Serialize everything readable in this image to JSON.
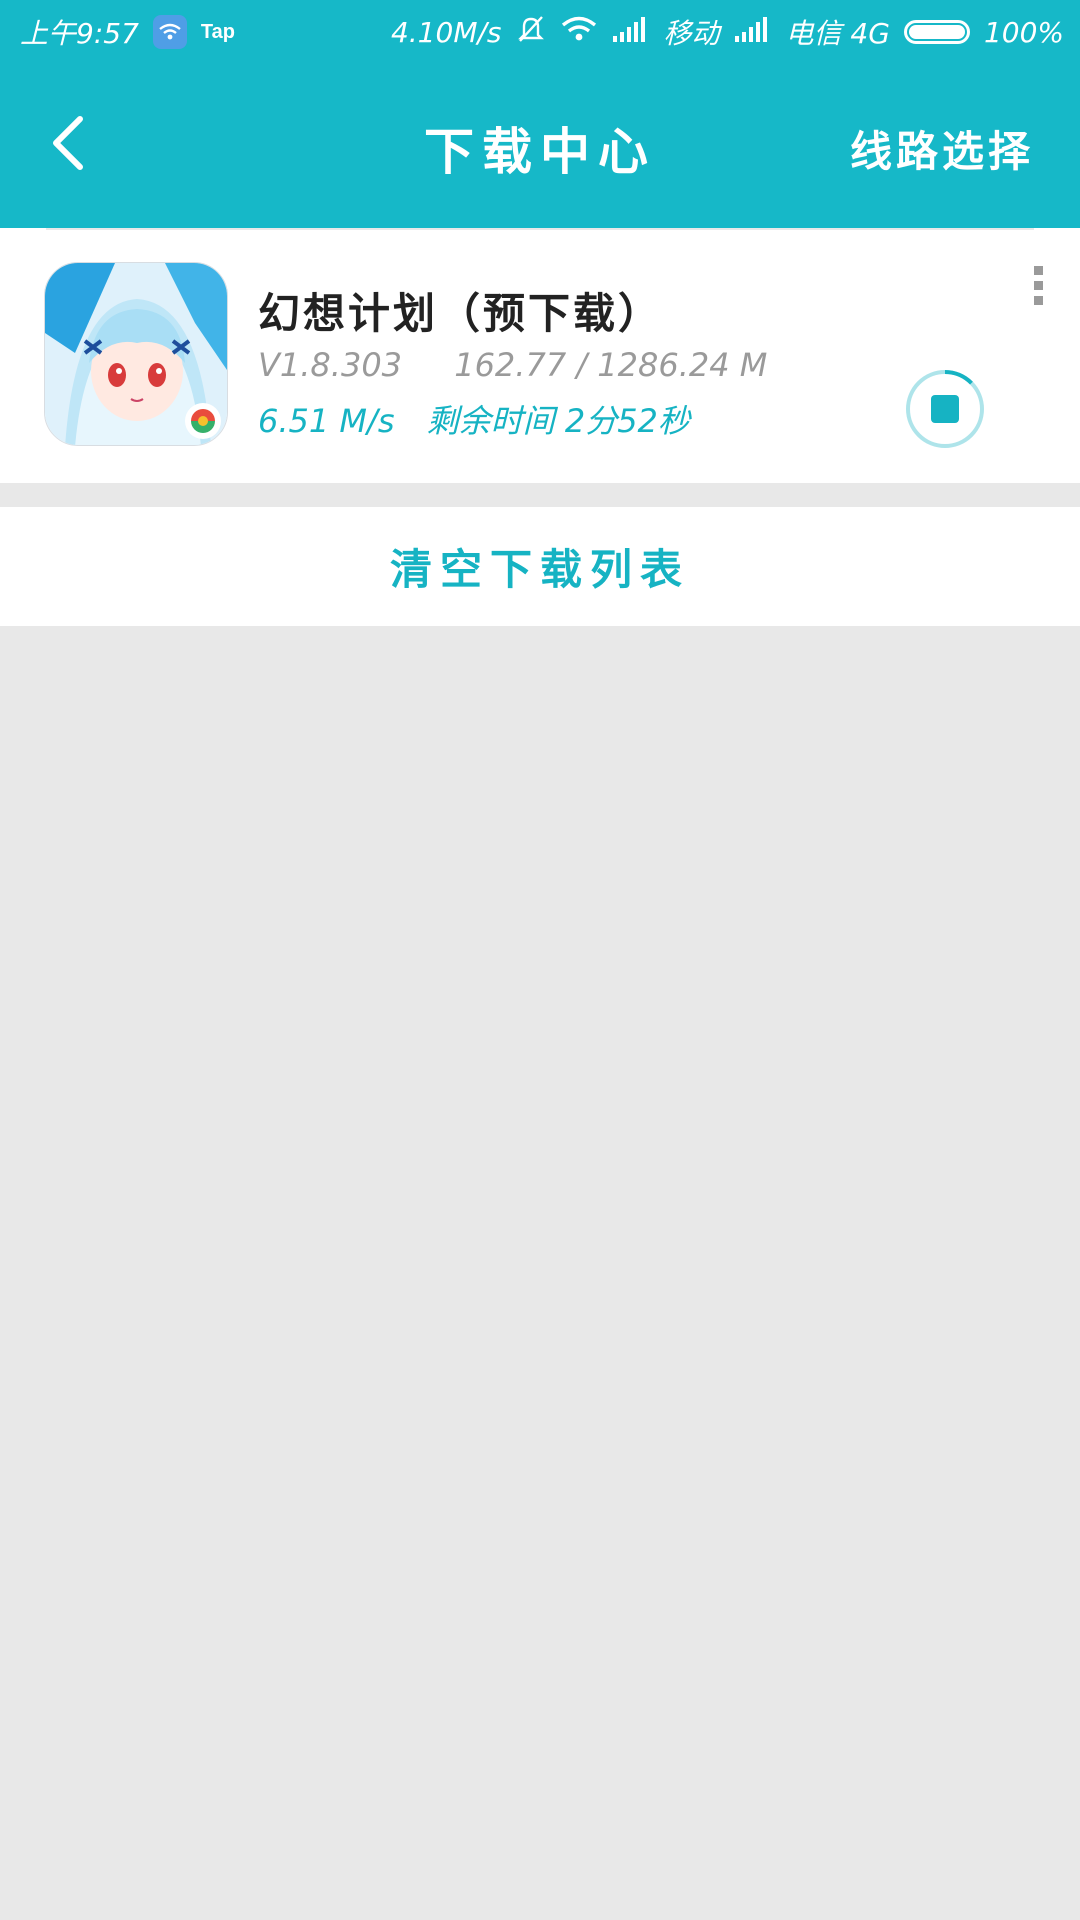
{
  "status_bar": {
    "time": "上午9:57",
    "tap_label": "Tap",
    "net_speed": "4.10M/s",
    "carrier1": "移动",
    "carrier2": "电信 4G",
    "battery": "100%"
  },
  "header": {
    "title": "下载中心",
    "route_label": "线路选择",
    "back_icon": "chevron-left-icon",
    "background_color": "#16b8c8"
  },
  "downloads": [
    {
      "name": "幻想计划（预下载）",
      "version": "V1.8.303",
      "size_progress": "162.77 / 1286.24 M",
      "speed": "6.51 M/s",
      "remaining": "剩余时间 2分52秒",
      "progress": 0.1265,
      "icon": "anime-girl-app-icon",
      "action_icon": "stop-icon",
      "menu_icon": "more-vertical-icon"
    }
  ],
  "footer_action": {
    "clear_label": "清空下载列表"
  },
  "colors": {
    "accent": "#16b3c3",
    "page_bg": "#e8e8e8",
    "meta_gray": "#9a9a9a"
  }
}
